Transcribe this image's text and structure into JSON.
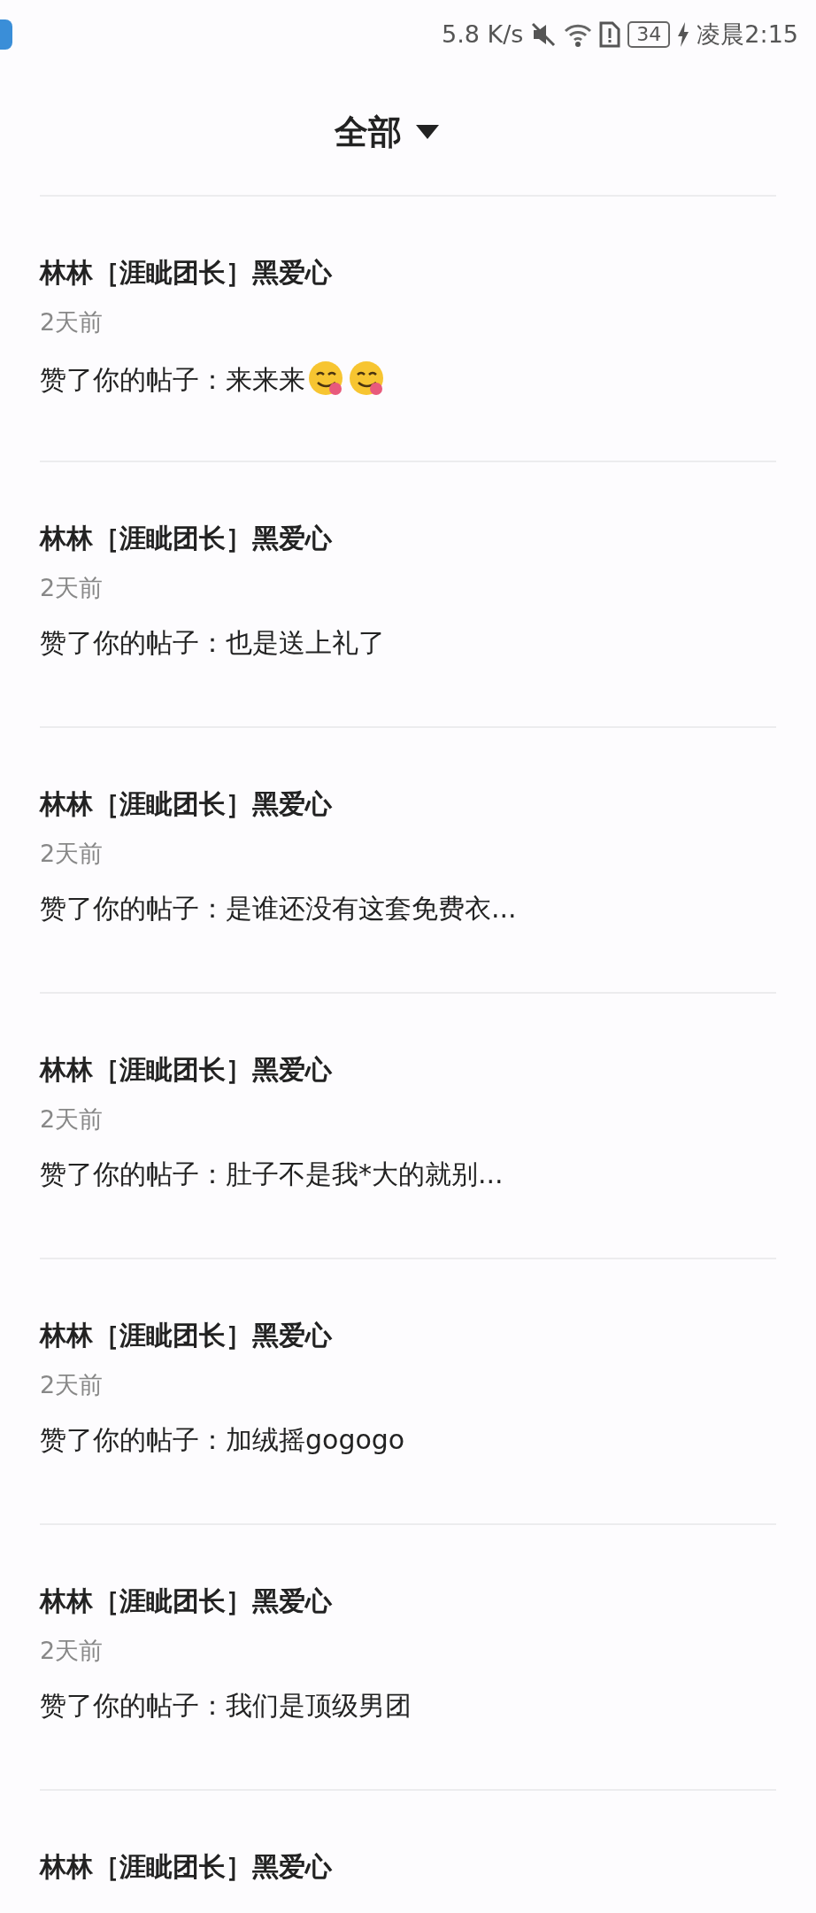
{
  "status_bar": {
    "speed": "5.8 K/s",
    "battery": "34",
    "time": "凌晨2:15"
  },
  "header": {
    "title": "全部"
  },
  "notifications": [
    {
      "name": "林林［涯眦团长］黑爱心",
      "time": "2天前",
      "text": "赞了你的帖子：来来来",
      "emojis": [
        {
          "kind": "tongue"
        },
        {
          "kind": "tongue"
        }
      ]
    },
    {
      "name": "林林［涯眦团长］黑爱心",
      "time": "2天前",
      "text": "赞了你的帖子：也是送上礼了"
    },
    {
      "name": "林林［涯眦团长］黑爱心",
      "time": "2天前",
      "text": "赞了你的帖子：是谁还没有这套免费衣..."
    },
    {
      "name": "林林［涯眦团长］黑爱心",
      "time": "2天前",
      "text": "赞了你的帖子：肚子不是我*大的就别..."
    },
    {
      "name": "林林［涯眦团长］黑爱心",
      "time": "2天前",
      "text": "赞了你的帖子：加绒摇gogogo"
    },
    {
      "name": "林林［涯眦团长］黑爱心",
      "time": "2天前",
      "text": "赞了你的帖子：我们是顶级男团"
    },
    {
      "name": "林林［涯眦团长］黑爱心"
    }
  ]
}
